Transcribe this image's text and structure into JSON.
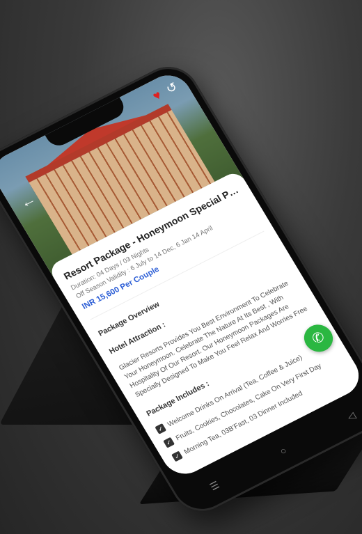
{
  "hero": {
    "back_icon": "arrow-left-icon",
    "favorite_icon": "heart-icon",
    "share_icon": "share-icon",
    "favorite_color": "#e02020"
  },
  "package": {
    "title": "Resort Package - Honeymoon Special Pac...",
    "duration": "Duration: 04 Days / 03 Nights",
    "validity": "Off Season Validity : 6 July to 14 Dec, 6 Jan 14 April",
    "price": "INR 15,600 Per Couple",
    "price_color": "#2d5fd6"
  },
  "overview": {
    "heading": "Package Overview",
    "hotel_heading": "Hotel Attraction :",
    "hotel_text": "Glacier Resorts Provides You Best Environment To Celebrate Your Honeymoon. Celebrate The Nature At Its Best , With Hospitality Of Our Resort. Our Honeymoon Packages Are Specially Designed To Make You Feel Relax And Worries Free",
    "includes_heading": "Package Includes :",
    "includes": [
      "Welcome Drinks On Arrival (Tea, Coffee & Juice)",
      "Fruits, Cookies, Chocolates, Cake On Very First Day",
      "Morning Tea, 03B'Fast, 03 Dinner Included"
    ]
  },
  "floating": {
    "whatsapp_icon": "whatsapp-icon",
    "whatsapp_color": "#2bb741"
  },
  "navbar": {
    "icons": [
      "menu-icon",
      "home-icon",
      "back-icon"
    ]
  }
}
